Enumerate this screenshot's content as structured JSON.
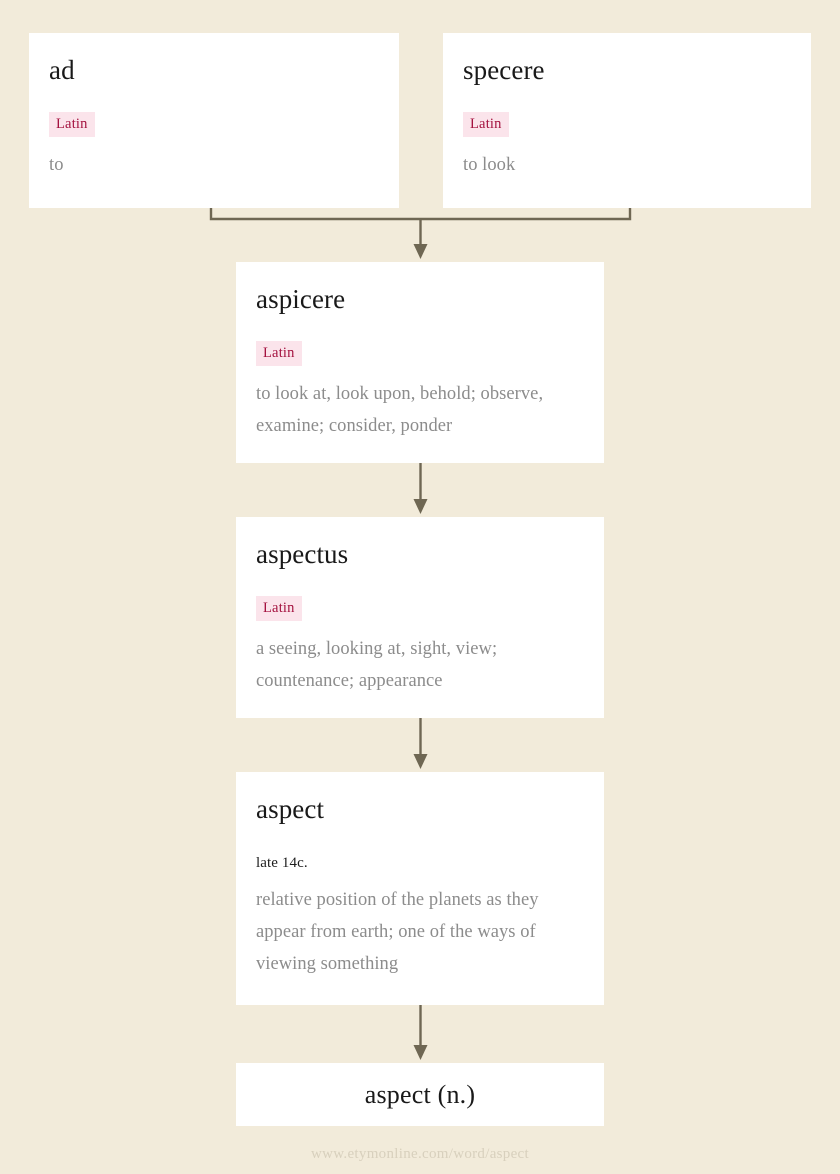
{
  "page": {
    "background_color": "#f2ebda",
    "card_background": "#ffffff",
    "tag_background": "#fbe4eb",
    "tag_text_color": "#a4123f",
    "gloss_color": "#8c8c8c",
    "connector_color": "#6f6753"
  },
  "nodes": {
    "ad": {
      "title": "ad",
      "language": "Latin",
      "gloss": "to"
    },
    "specere": {
      "title": "specere",
      "language": "Latin",
      "gloss": "to look"
    },
    "aspicere": {
      "title": "aspicere",
      "language": "Latin",
      "gloss": "to look at, look upon, behold; observe, examine; consider, ponder"
    },
    "aspectus": {
      "title": "aspectus",
      "language": "Latin",
      "gloss": "a seeing, looking at, sight, view; countenance; appearance"
    },
    "aspect": {
      "title": "aspect",
      "date": "late 14c.",
      "gloss": "relative position of the planets as they appear from earth; one of the ways of viewing something"
    },
    "result": {
      "title": "aspect (n.)"
    }
  },
  "footer": {
    "source_url": "www.etymonline.com/word/aspect"
  }
}
